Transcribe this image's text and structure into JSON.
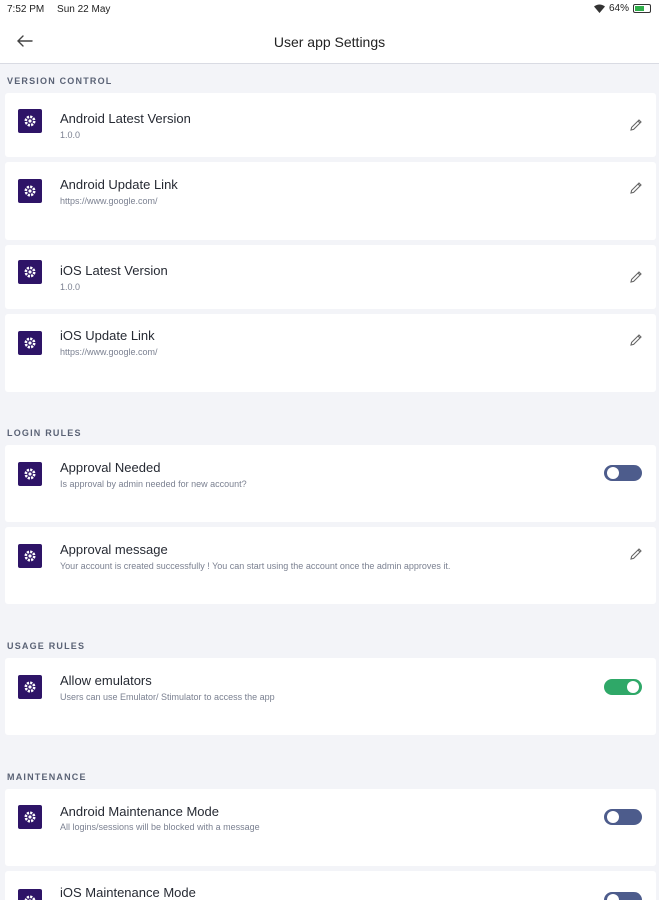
{
  "status_bar": {
    "time": "7:52 PM",
    "date": "Sun 22 May",
    "battery": "64%",
    "battery_level": 0.64
  },
  "app_bar": {
    "title": "User app Settings",
    "back_icon": "arrow-left-icon"
  },
  "sections": {
    "version_control": "VERSION CONTROL",
    "login_rules": "LOGIN RULES",
    "usage_rules": "USAGE RULES",
    "maintenance": "MAINTENANCE"
  },
  "settings": {
    "android_latest_version": {
      "title": "Android Latest Version",
      "value": "1.0.0"
    },
    "android_update_link": {
      "title": "Android Update Link",
      "value": "https://www.google.com/"
    },
    "ios_latest_version": {
      "title": "iOS Latest Version",
      "value": "1.0.0"
    },
    "ios_update_link": {
      "title": "iOS Update Link",
      "value": "https://www.google.com/"
    },
    "approval_needed": {
      "title": "Approval Needed",
      "desc": "Is approval by admin needed for new account?",
      "enabled": false
    },
    "approval_message": {
      "title": "Approval message",
      "value": "Your account is created successfully ! You can start using the account once the admin approves it."
    },
    "allow_emulators": {
      "title": "Allow emulators",
      "desc": "Users can use Emulator/ Stimulator to access the app",
      "enabled": true
    },
    "android_maintenance": {
      "title": "Android Maintenance Mode",
      "desc": "All logins/sessions will be blocked with a message",
      "enabled": false
    },
    "ios_maintenance": {
      "title": "iOS Maintenance Mode",
      "enabled": false
    }
  },
  "colors": {
    "gear_bg": "#2e1467",
    "toggle_off": "#4d5c8c",
    "toggle_on": "#2fa868",
    "page_bg": "#f3f4f8"
  }
}
